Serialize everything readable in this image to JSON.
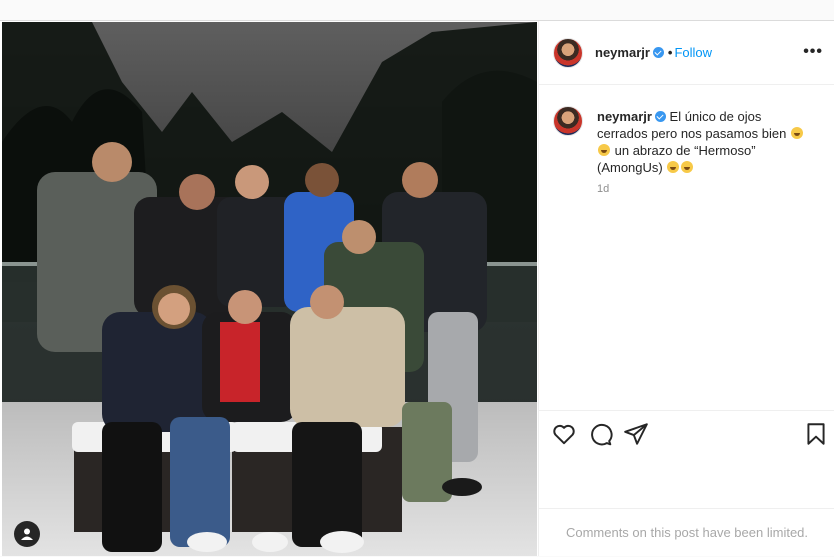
{
  "post": {
    "username": "neymarjr",
    "separator": "•",
    "follow_label": "Follow",
    "more_label": "•••",
    "caption_lines": [
      "El único de ojos",
      "cerrados pero nos pasamos bien",
      "un abrazo de “Hermoso”",
      "(AmongUs)"
    ],
    "time_ago": "1d",
    "comments_limited": "Comments on this post have been limited."
  },
  "icons": {
    "like": "heart-icon",
    "comment": "comment-icon",
    "share": "paper-plane-icon",
    "save": "bookmark-icon",
    "tag": "user-tag-icon",
    "verified": "verified-badge-icon",
    "more": "more-options-icon"
  },
  "colors": {
    "link": "#0095f6",
    "verified": "#3897f0",
    "muted": "#8e8e8e"
  }
}
